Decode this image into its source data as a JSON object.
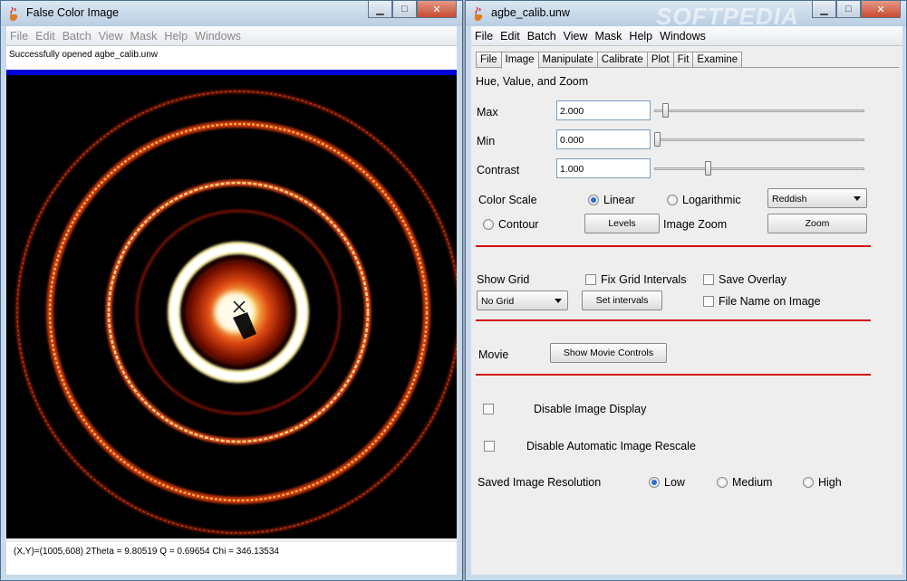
{
  "left_window": {
    "title": "False Color Image",
    "menu": [
      "File",
      "Edit",
      "Batch",
      "View",
      "Mask",
      "Help",
      "Windows"
    ],
    "status": "Successfully opened agbe_calib.unw",
    "coords": "(X,Y)=(1005,608)  2Theta = 9.80519 Q = 0.69654 Chi = 346.13534"
  },
  "right_window": {
    "title": "agbe_calib.unw",
    "watermark": "SOFTPEDIA",
    "menu": [
      "File",
      "Edit",
      "Batch",
      "View",
      "Mask",
      "Help",
      "Windows"
    ],
    "tabs": [
      "File",
      "Image",
      "Manipulate",
      "Calibrate",
      "Plot",
      "Fit",
      "Examine"
    ],
    "active_tab": "Image",
    "section_title": "Hue, Value, and Zoom",
    "max_label": "Max",
    "max_value": "2.000",
    "max_slider": 0.04,
    "min_label": "Min",
    "min_value": "0.000",
    "min_slider": 0.0,
    "contrast_label": "Contrast",
    "contrast_value": "1.000",
    "contrast_slider": 0.25,
    "color_scale_label": "Color Scale",
    "linear_label": "Linear",
    "log_label": "Logarithmic",
    "color_scheme": "Reddish",
    "contour_label": "Contour",
    "levels_label": "Levels",
    "image_zoom_label": "Image Zoom",
    "zoom_label": "Zoom",
    "show_grid_label": "Show Grid",
    "fix_grid_label": "Fix Grid Intervals",
    "save_overlay_label": "Save Overlay",
    "grid_option": "No Grid",
    "set_intervals_label": "Set intervals",
    "file_name_label": "File Name on Image",
    "movie_label": "Movie",
    "movie_button": "Show Movie Controls",
    "disable_display_label": "Disable Image Display",
    "disable_rescale_label": "Disable Automatic Image Rescale",
    "resolution_label": "Saved Image Resolution",
    "res_low": "Low",
    "res_medium": "Medium",
    "res_high": "High"
  },
  "colors": {
    "accent_red": "#d01010",
    "status_blue": "#0000d8",
    "radio_blue": "#2a6ed0"
  },
  "icons": {
    "java": "java-cup-icon",
    "minimize": "minimize-icon",
    "maximize": "maximize-icon",
    "close": "close-icon"
  }
}
